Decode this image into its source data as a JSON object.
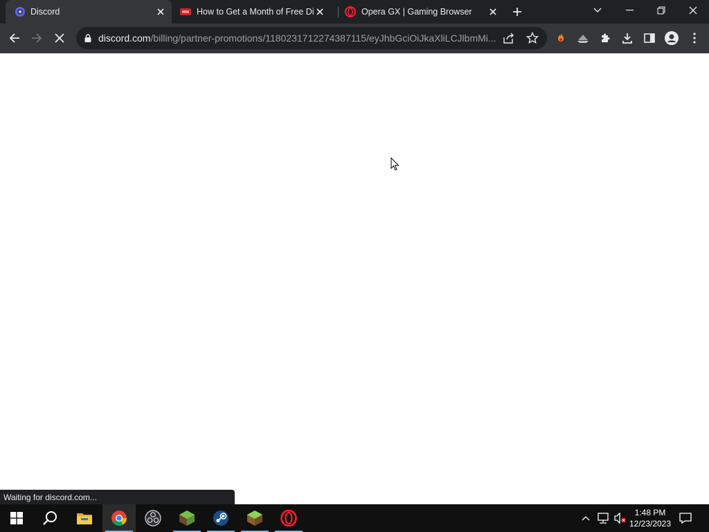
{
  "browser": {
    "tabs": [
      {
        "title": "Discord",
        "icon": "discord-icon",
        "active": true
      },
      {
        "title": "How to Get a Month of Free Discord",
        "icon": "video-site-icon",
        "active": false
      },
      {
        "title": "Opera GX | Gaming Browser",
        "icon": "opera-icon",
        "active": false
      }
    ],
    "address": {
      "host": "discord.com",
      "path": "/billing/partner-promotions/1180231712274387115/eyJhbGciOiJkaXliLCJlbmMi..."
    },
    "status": "Waiting for discord.com..."
  },
  "taskbar": {
    "apps": [
      "windows-start-icon",
      "search-icon",
      "file-explorer-icon",
      "chrome-icon",
      "obs-icon",
      "minecraft-launcher-icon",
      "steam-icon",
      "minecraft-icon",
      "opera-gx-icon"
    ],
    "time": "1:48 PM",
    "date": "12/23/2023"
  },
  "colors": {
    "frame": "#202124",
    "toolbar": "#35363a",
    "taskbar": "#101010"
  }
}
